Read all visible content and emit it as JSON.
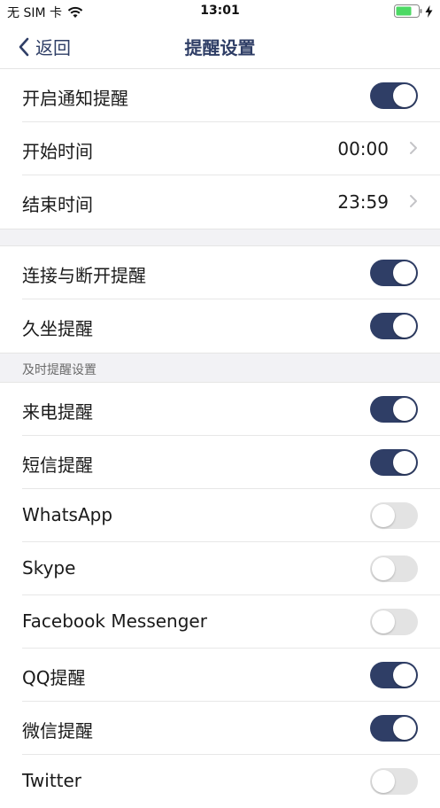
{
  "status_bar": {
    "carrier": "无 SIM 卡",
    "time": "13:01"
  },
  "nav": {
    "back_label": "返回",
    "title": "提醒设置"
  },
  "section1": [
    {
      "label": "开启通知提醒",
      "type": "toggle",
      "on": true
    },
    {
      "label": "开始时间",
      "type": "value",
      "value": "00:00"
    },
    {
      "label": "结束时间",
      "type": "value",
      "value": "23:59"
    }
  ],
  "section2": [
    {
      "label": "连接与断开提醒",
      "type": "toggle",
      "on": true
    },
    {
      "label": "久坐提醒",
      "type": "toggle",
      "on": true
    }
  ],
  "section3_header": "及时提醒设置",
  "section3": [
    {
      "label": "来电提醒",
      "type": "toggle",
      "on": true
    },
    {
      "label": "短信提醒",
      "type": "toggle",
      "on": true
    },
    {
      "label": "WhatsApp",
      "type": "toggle",
      "on": false
    },
    {
      "label": "Skype",
      "type": "toggle",
      "on": false
    },
    {
      "label": "Facebook Messenger",
      "type": "toggle",
      "on": false
    },
    {
      "label": "QQ提醒",
      "type": "toggle",
      "on": true
    },
    {
      "label": "微信提醒",
      "type": "toggle",
      "on": true
    },
    {
      "label": "Twitter",
      "type": "toggle",
      "on": false
    }
  ],
  "colors": {
    "accent": "#2f3e66",
    "toggle_off": "#e3e3e3",
    "section_bg": "#f2f2f5"
  }
}
